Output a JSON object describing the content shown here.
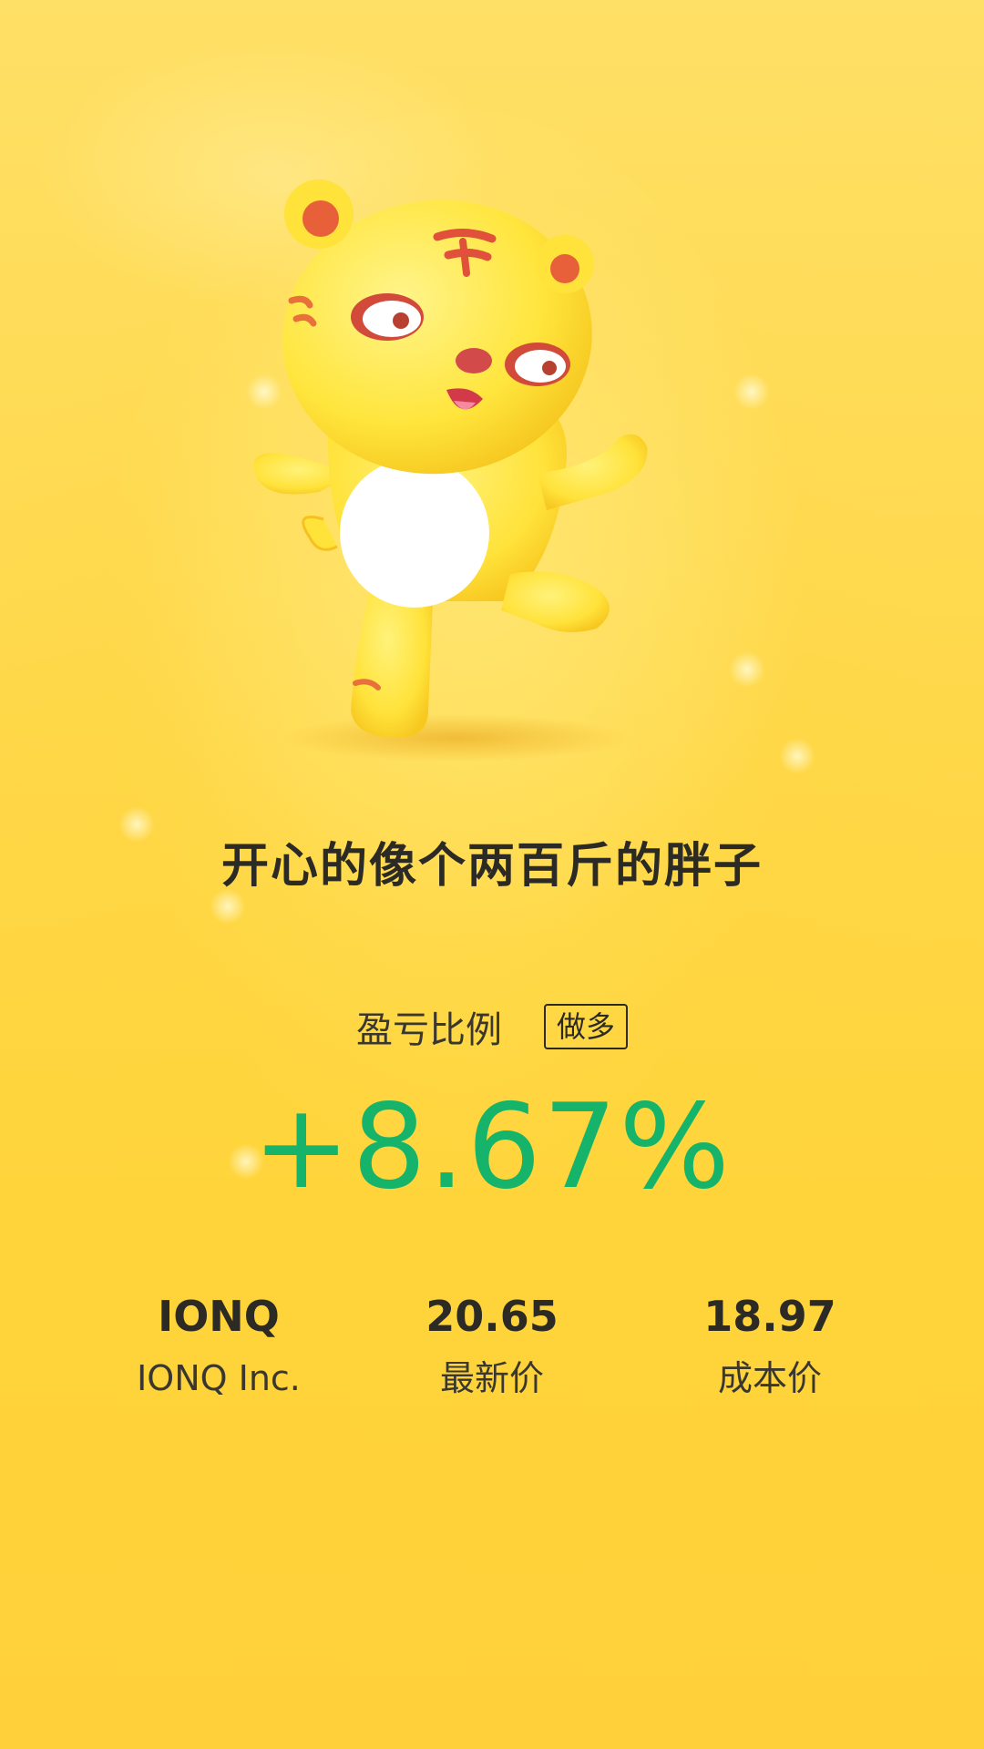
{
  "headline": "开心的像个两百斤的胖子",
  "profit": {
    "label": "盈亏比例",
    "direction": "做多",
    "percent": "+8.67%",
    "color": "#16b46a"
  },
  "stock": {
    "symbol": "IONQ",
    "name": "IONQ Inc.",
    "latest_price": "20.65",
    "latest_price_label": "最新价",
    "cost_price": "18.97",
    "cost_price_label": "成本价"
  },
  "colors": {
    "background": "#ffd84a",
    "text": "#2c2a24",
    "gain": "#16b46a"
  },
  "illustration": "happy-tiger-mascot"
}
